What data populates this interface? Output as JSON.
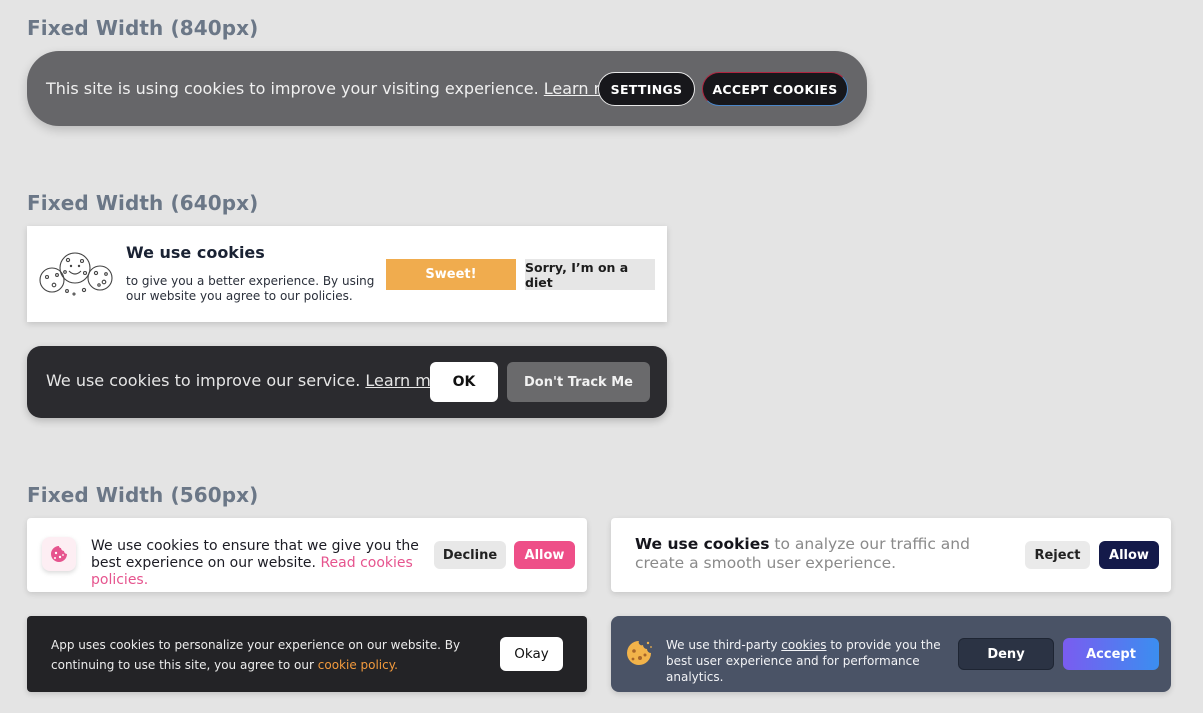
{
  "sections": {
    "w840": "Fixed Width (840px)",
    "w640": "Fixed Width (640px)",
    "w560": "Fixed Width (560px)"
  },
  "banner840": {
    "message": "This site is using cookies to improve your visiting experience.",
    "link": "Learn more",
    "settings": "SETTINGS",
    "accept": "ACCEPT COOKIES"
  },
  "banner640a": {
    "icon": "cookies-illustration-icon",
    "heading": "We use cookies",
    "sub": "to give you a better experience. By using our website you agree to our policies.",
    "sweet": "Sweet!",
    "diet": "Sorry, I’m on a diet"
  },
  "banner640b": {
    "message": "We use cookies to improve our service.",
    "link": "Learn more",
    "ok": "OK",
    "dont_track": "Don't Track Me"
  },
  "banner560a": {
    "icon": "cookie-icon",
    "message": "We use cookies to ensure that we give you the best experience on our website.",
    "link": "Read cookies policies.",
    "decline": "Decline",
    "allow": "Allow"
  },
  "banner560b": {
    "bold": "We use cookies",
    "message": "to analyze our traffic and create a smooth user experience.",
    "reject": "Reject",
    "allow": "Allow"
  },
  "banner560c": {
    "message": "App uses cookies to personalize your experience on our website. By continuing to use this site, you agree to our",
    "link": "cookie policy.",
    "okay": "Okay"
  },
  "banner560d": {
    "icon": "cookie-icon",
    "message_pre": "We use third-party",
    "link": "cookies",
    "message_post": "to provide you the best user experience and for performance analytics.",
    "deny": "Deny",
    "accept": "Accept"
  },
  "colors": {
    "background": "#e4e4e4",
    "title": "#6b7787",
    "pink": "#ee4f88",
    "orange": "#f0ac4e",
    "navy": "#141a4a"
  }
}
